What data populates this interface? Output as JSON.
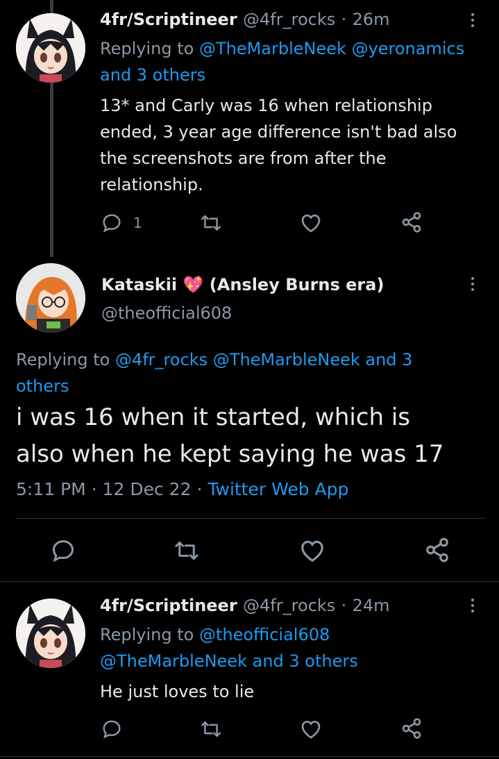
{
  "tweet1": {
    "name": "4fr/Scriptineer",
    "handle": "@4fr_rocks",
    "sep": "·",
    "time": "26m",
    "replying_prefix": "Replying to",
    "reply_handle_1": "@TheMarbleNeek",
    "reply_handle_2": "@yeronamics",
    "reply_others": "and 3 others",
    "text_lines": [
      "13* and Carly was 16 when relationship",
      "ended, 3 year age difference isn't bad also",
      "the screenshots are from after the",
      "relationship."
    ],
    "reply_count": "1"
  },
  "main_tweet": {
    "name": "Kataskii",
    "emoji": "💖",
    "name_suffix": "(Ansley Burns era)",
    "handle": "@theofficial608",
    "replying_prefix": "Replying to",
    "reply_line_1": "@4fr_rocks @TheMarbleNeek and 3",
    "reply_line_2": "others",
    "text_lines": [
      "i was 16 when it started, which is",
      "also when he kept saying he was 17"
    ],
    "time": "5:11 PM",
    "sep1": "·",
    "date": "12 Dec 22",
    "sep2": "·",
    "source": "Twitter Web App"
  },
  "tweet3": {
    "name": "4fr/Scriptineer",
    "handle": "@4fr_rocks",
    "sep": "·",
    "time": "24m",
    "replying_prefix": "Replying to",
    "reply_handle_1": "@theofficial608",
    "reply_line_2": "@TheMarbleNeek and 3 others",
    "text": "He just loves to lie"
  },
  "colors": {
    "background": "#000000",
    "text": "#e7e9ea",
    "muted": "#8b98a5",
    "link": "#1d9bf0",
    "divider": "#2f3336",
    "emoji_heart": "#ff4fa3"
  }
}
